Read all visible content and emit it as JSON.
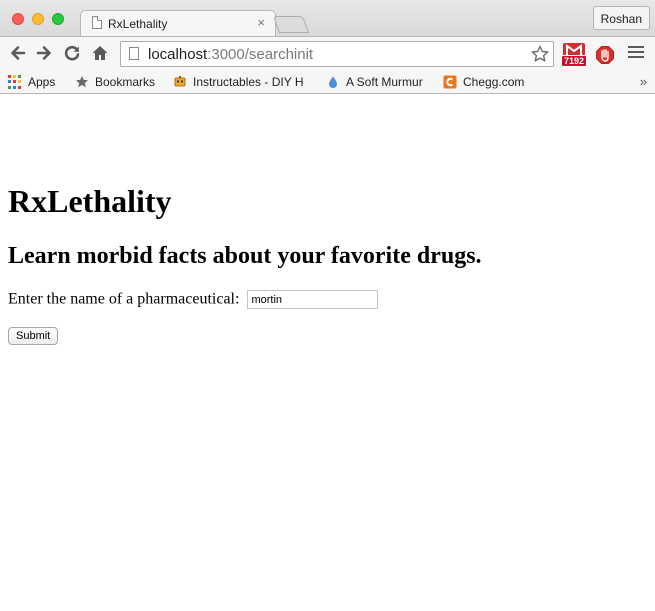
{
  "browser": {
    "tab": {
      "title": "RxLethality",
      "close_glyph": "×"
    },
    "profile_name": "Roshan",
    "address": {
      "host": "localhost",
      "path": ":3000/searchinit"
    },
    "extensions": {
      "gmail_count": "7192"
    },
    "bookmarks": [
      {
        "label": "Apps",
        "icon": "apps-grid-icon"
      },
      {
        "label": "Bookmarks",
        "icon": "star-icon"
      },
      {
        "label": "Instructables - DIY H",
        "icon": "instructables-robot-icon"
      },
      {
        "label": "A Soft Murmur",
        "icon": "water-drop-icon"
      },
      {
        "label": "Chegg.com",
        "icon": "chegg-icon"
      }
    ],
    "bookmarks_overflow": "»"
  },
  "page": {
    "title": "RxLethality",
    "subtitle": "Learn morbid facts about your favorite drugs.",
    "search_label": "Enter the name of a pharmaceutical:",
    "search_value": "mortin",
    "submit_label": "Submit"
  },
  "colors": {
    "chrome_bg": "#f6f6f6",
    "close": "#fc5f57",
    "minimize": "#fdbc2e",
    "maximize": "#28c840",
    "gmail_red": "#cf2f2f",
    "chegg_orange": "#e87722"
  }
}
